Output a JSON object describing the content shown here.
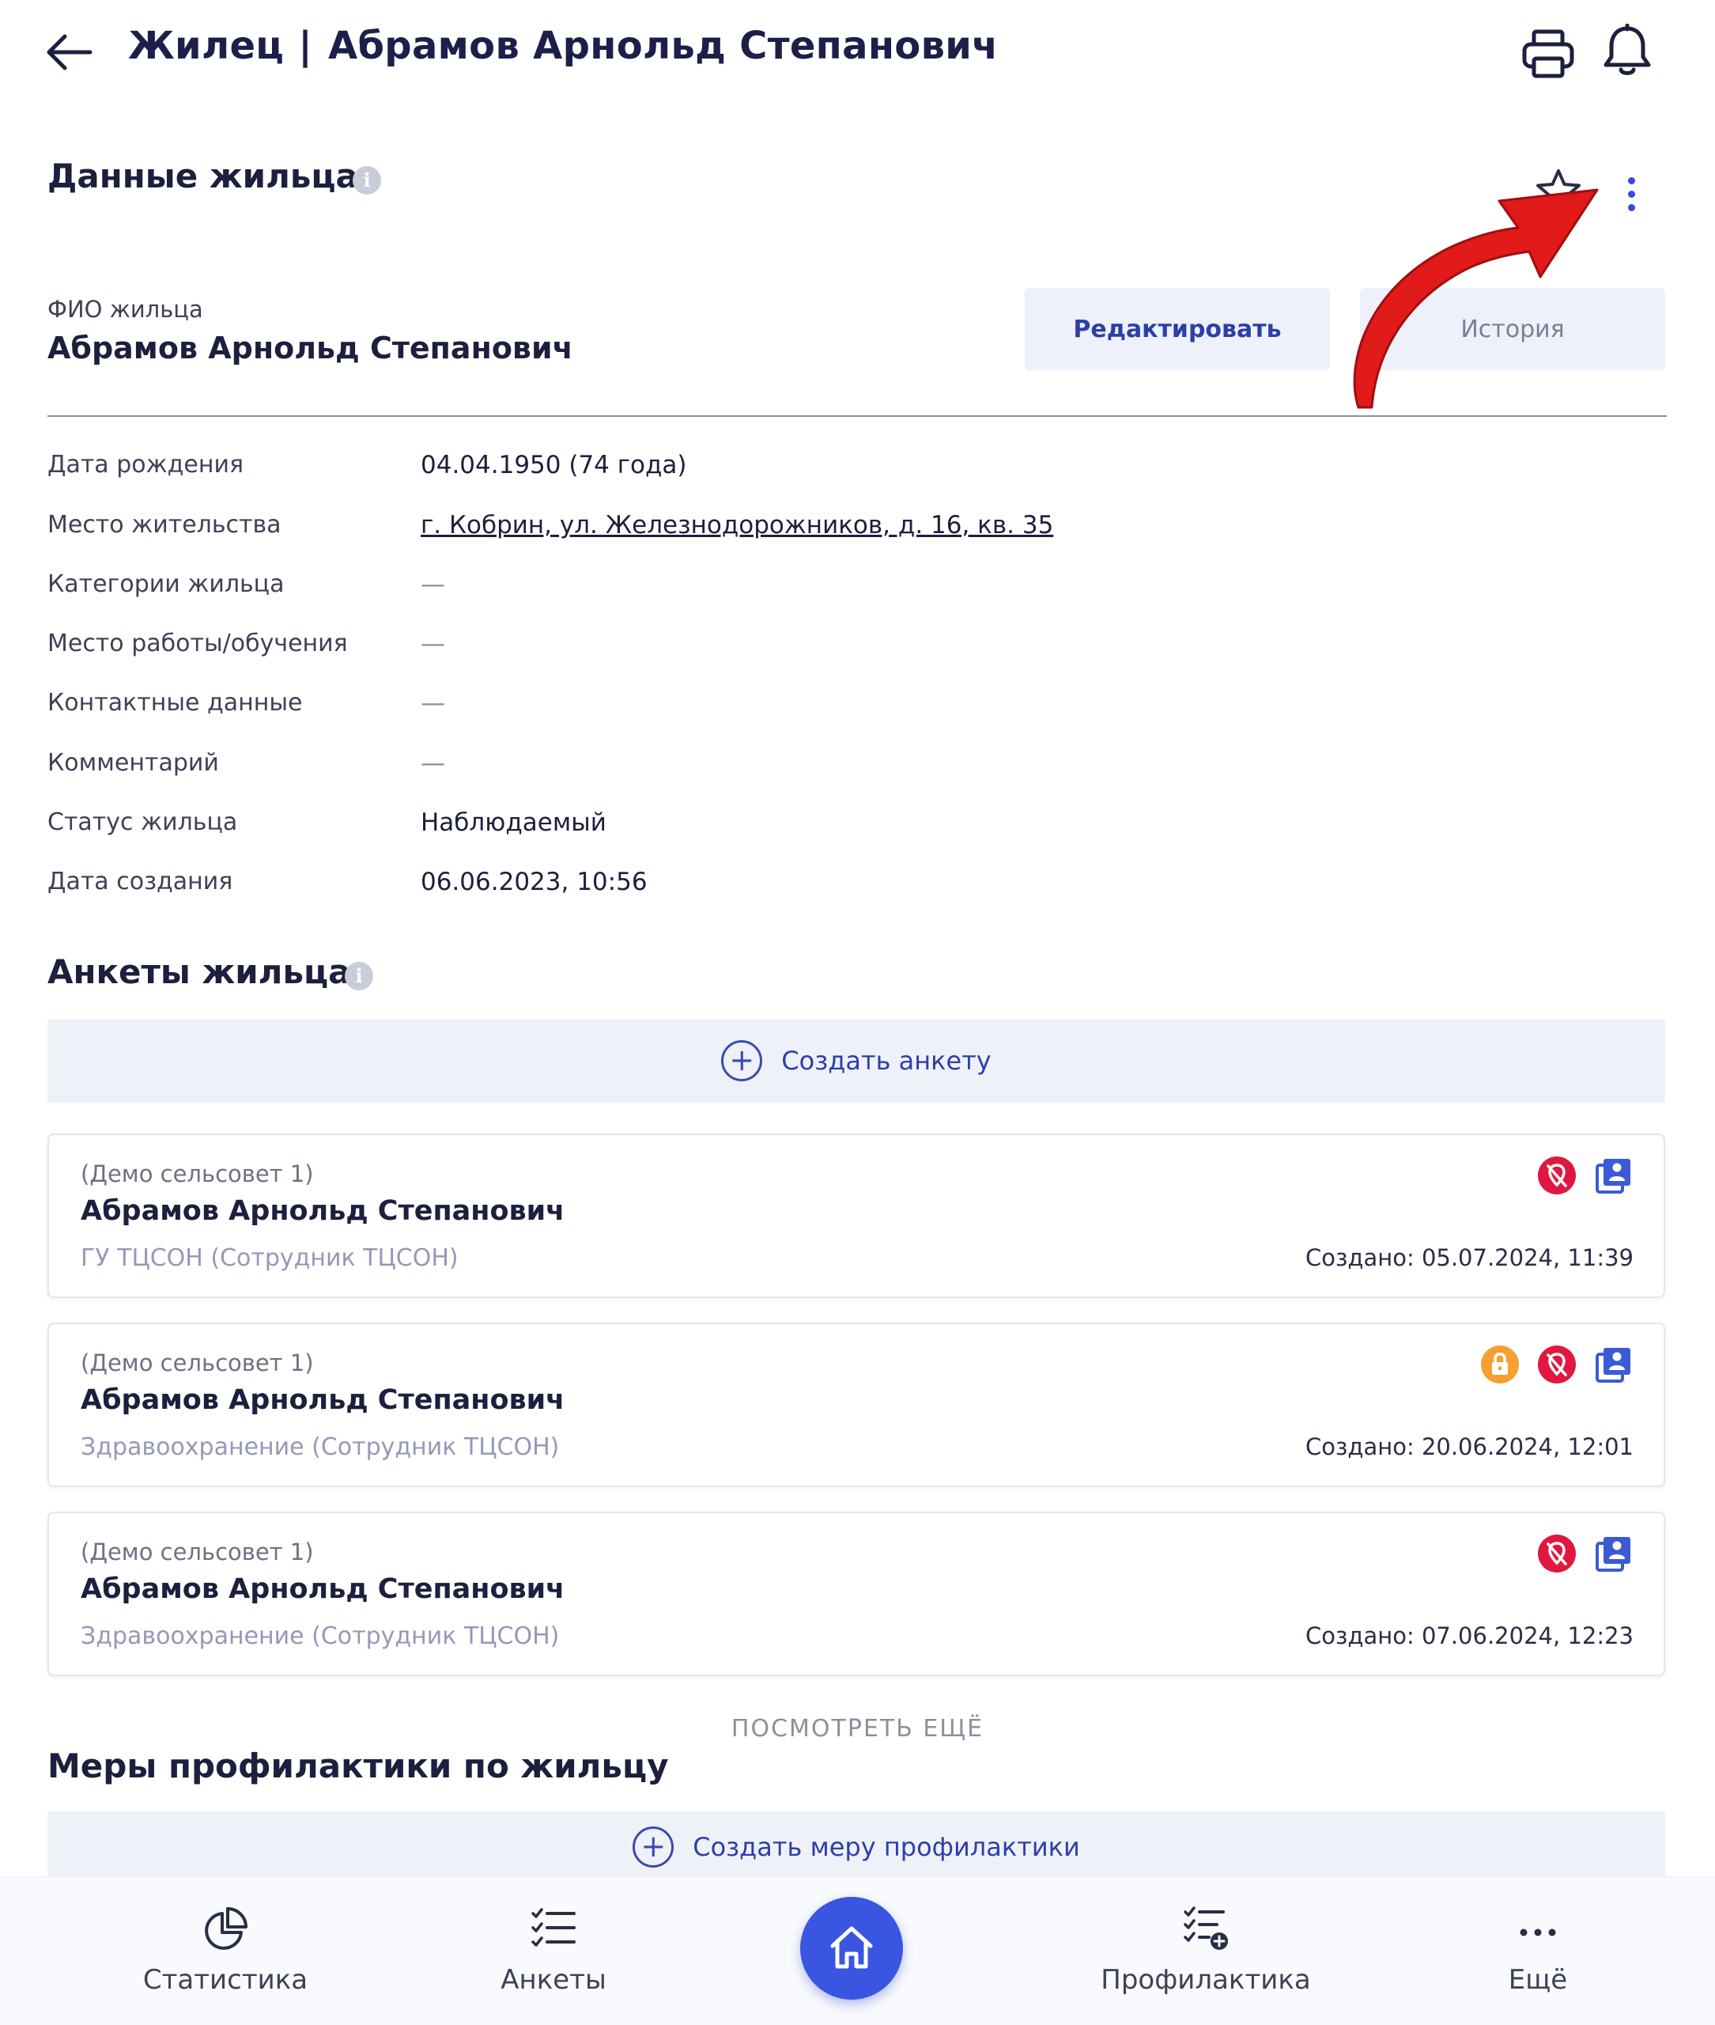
{
  "header": {
    "section": "Жилец",
    "separator": "|",
    "resident_name": "Абрамов Арнольд Степанович"
  },
  "resident": {
    "title": "Данные жильца",
    "fio_label": "ФИО жильца",
    "fio_value": "Абрамов Арнольд Степанович",
    "edit_label": "Редактировать",
    "history_label": "История",
    "fields": [
      {
        "label": "Дата рождения",
        "value": "04.04.1950 (74 года)"
      },
      {
        "label": "Место жительства",
        "value": "г. Кобрин, ул. Железнодорожников, д. 16, кв. 35"
      },
      {
        "label": "Категории жильца",
        "value": "—"
      },
      {
        "label": "Место работы/обучения",
        "value": "—"
      },
      {
        "label": "Контактные данные",
        "value": "—"
      },
      {
        "label": "Комментарий",
        "value": "—"
      },
      {
        "label": "Статус жильца",
        "value": "Наблюдаемый"
      },
      {
        "label": "Дата создания",
        "value": "06.06.2023, 10:56"
      }
    ]
  },
  "questionnaires": {
    "title": "Анкеты жильца",
    "create_label": "Создать анкету",
    "items": [
      {
        "org": "(Демо сельсовет 1)",
        "name": "Абрамов Арнольд Степанович",
        "dept": "ГУ ТЦСОН (Сотрудник ТЦСОН)",
        "date": "Создано: 05.07.2024, 11:39",
        "icons": [
          "no-location-icon",
          "contact-book-icon"
        ]
      },
      {
        "org": "(Демо сельсовет 1)",
        "name": "Абрамов Арнольд Степанович",
        "dept": "Здравоохранение (Сотрудник ТЦСОН)",
        "date": "Создано: 20.06.2024, 12:01",
        "icons": [
          "lock-icon",
          "no-location-icon",
          "contact-book-icon"
        ]
      },
      {
        "org": "(Демо сельсовет 1)",
        "name": "Абрамов Арнольд Степанович",
        "dept": "Здравоохранение (Сотрудник ТЦСОН)",
        "date": "Создано: 07.06.2024, 12:23",
        "icons": [
          "no-location-icon",
          "contact-book-icon"
        ]
      }
    ],
    "see_more": "ПОСМОТРЕТЬ ЕЩЁ"
  },
  "prevention": {
    "title": "Меры профилактики по жильцу",
    "create_label": "Создать меру профилактики"
  },
  "nav": {
    "stats": "Статистика",
    "forms": "Анкеты",
    "prevention": "Профилактика",
    "more": "Ещё"
  },
  "colors": {
    "accent": "#3a55e0",
    "title": "#1c1f3d",
    "danger": "#e0183f",
    "warning": "#f5a030",
    "contact": "#3b5bd6"
  }
}
